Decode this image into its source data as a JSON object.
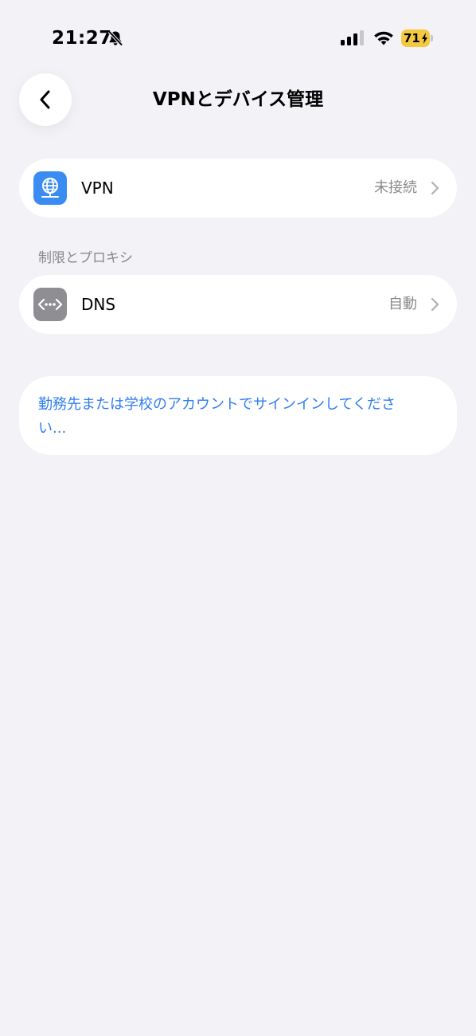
{
  "status_bar": {
    "time": "21:27",
    "battery_level": "71"
  },
  "nav": {
    "title": "VPNとデバイス管理"
  },
  "rows": {
    "vpn": {
      "label": "VPN",
      "value": "未接続"
    },
    "dns": {
      "label": "DNS",
      "value": "自動"
    }
  },
  "sections": {
    "restrictions_header": "制限とプロキシ"
  },
  "signin": {
    "text": "勤務先または学校のアカウントでサインインしてください..."
  },
  "colors": {
    "background": "#f2f2f7",
    "accent": "#2f7ef0",
    "battery": "#f5c842",
    "vpn_icon_bg": "#3b8cf2",
    "dns_icon_bg": "#8e8e93"
  },
  "icons": {
    "bell": "bell-slash-icon",
    "signal": "cellular-signal-icon",
    "wifi": "wifi-icon",
    "back": "chevron-left-icon",
    "vpn": "globe-network-icon",
    "dns": "dns-dots-icon",
    "chevron": "chevron-right-icon"
  }
}
